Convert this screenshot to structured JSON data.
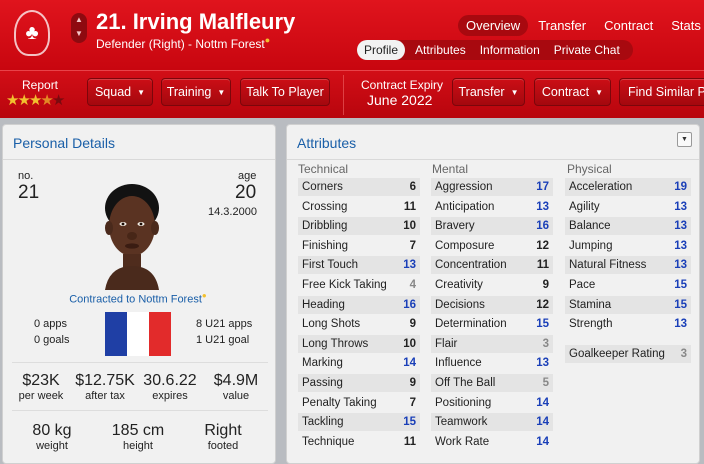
{
  "header": {
    "title": "21. Irving Malfleury",
    "subtitle": "Defender (Right) - Nottm Forest",
    "subtitle_mark": "●",
    "crest_glyph": "♣",
    "nav": [
      {
        "label": "Overview",
        "active": true
      },
      {
        "label": "Transfer",
        "active": false
      },
      {
        "label": "Contract",
        "active": false
      },
      {
        "label": "Stats",
        "active": false
      }
    ],
    "subnav": [
      {
        "label": "Profile",
        "active": true
      },
      {
        "label": "Attributes",
        "active": false
      },
      {
        "label": "Information",
        "active": false
      },
      {
        "label": "Private Chat",
        "active": false
      }
    ]
  },
  "actions": {
    "report_label": "Report",
    "report_stars": 3.5,
    "squad": "Squad",
    "training": "Training",
    "talk": "Talk To Player",
    "expiry_label": "Contract Expiry",
    "expiry_value": "June 2022",
    "transfer": "Transfer",
    "contract": "Contract",
    "find_similar": "Find Similar P"
  },
  "personal": {
    "title": "Personal Details",
    "no_label": "no.",
    "no_value": "21",
    "age_label": "age",
    "age_value": "20",
    "dob": "14.3.2000",
    "contracted": "Contracted to Nottm Forest",
    "apps": "0 apps",
    "goals": "0 goals",
    "u21_apps": "8 U21 apps",
    "u21_goals": "1 U21 goal",
    "wage": "$23K",
    "wage_label": "per week",
    "after_tax": "$12.75K",
    "after_tax_label": "after tax",
    "expires": "30.6.22",
    "expires_label": "expires",
    "value": "$4.9M",
    "value_label": "value",
    "weight": "80 kg",
    "weight_label": "weight",
    "height": "185 cm",
    "height_label": "height",
    "foot": "Right",
    "foot_label": "footed",
    "flag_colors": [
      "#1f3fa5",
      "#ffffff",
      "#e22b2b"
    ]
  },
  "attributes": {
    "title": "Attributes",
    "technical_label": "Technical",
    "mental_label": "Mental",
    "physical_label": "Physical",
    "technical": [
      {
        "name": "Corners",
        "value": 6
      },
      {
        "name": "Crossing",
        "value": 11
      },
      {
        "name": "Dribbling",
        "value": 10
      },
      {
        "name": "Finishing",
        "value": 7
      },
      {
        "name": "First Touch",
        "value": 13
      },
      {
        "name": "Free Kick Taking",
        "value": 4
      },
      {
        "name": "Heading",
        "value": 16
      },
      {
        "name": "Long Shots",
        "value": 9
      },
      {
        "name": "Long Throws",
        "value": 10
      },
      {
        "name": "Marking",
        "value": 14
      },
      {
        "name": "Passing",
        "value": 9
      },
      {
        "name": "Penalty Taking",
        "value": 7
      },
      {
        "name": "Tackling",
        "value": 15
      },
      {
        "name": "Technique",
        "value": 11
      }
    ],
    "mental": [
      {
        "name": "Aggression",
        "value": 17
      },
      {
        "name": "Anticipation",
        "value": 13
      },
      {
        "name": "Bravery",
        "value": 16
      },
      {
        "name": "Composure",
        "value": 12
      },
      {
        "name": "Concentration",
        "value": 11
      },
      {
        "name": "Creativity",
        "value": 9
      },
      {
        "name": "Decisions",
        "value": 12
      },
      {
        "name": "Determination",
        "value": 15
      },
      {
        "name": "Flair",
        "value": 3
      },
      {
        "name": "Influence",
        "value": 13
      },
      {
        "name": "Off The Ball",
        "value": 5
      },
      {
        "name": "Positioning",
        "value": 14
      },
      {
        "name": "Teamwork",
        "value": 14
      },
      {
        "name": "Work Rate",
        "value": 14
      }
    ],
    "physical": [
      {
        "name": "Acceleration",
        "value": 19
      },
      {
        "name": "Agility",
        "value": 13
      },
      {
        "name": "Balance",
        "value": 13
      },
      {
        "name": "Jumping",
        "value": 13
      },
      {
        "name": "Natural Fitness",
        "value": 13
      },
      {
        "name": "Pace",
        "value": 15
      },
      {
        "name": "Stamina",
        "value": 15
      },
      {
        "name": "Strength",
        "value": 13
      }
    ],
    "goalkeeper": {
      "name": "Goalkeeper Rating",
      "value": 3
    }
  }
}
